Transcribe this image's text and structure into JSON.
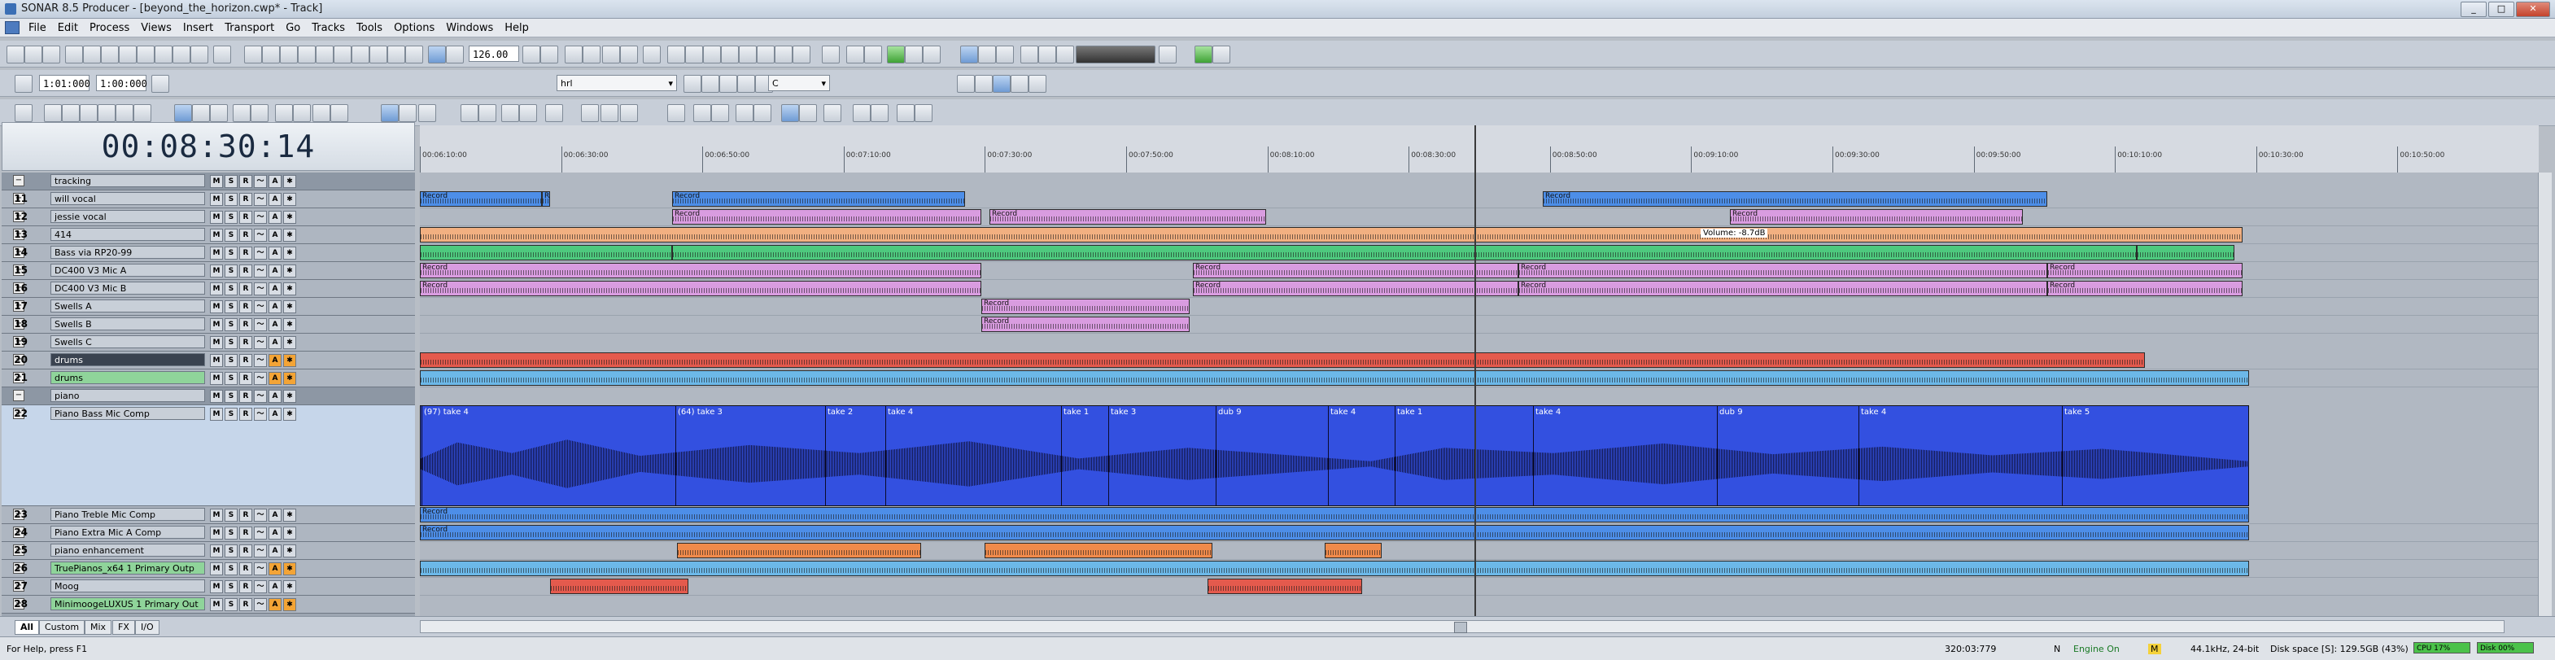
{
  "window": {
    "title": "SONAR 8.5 Producer - [beyond_the_horizon.cwp* - Track]"
  },
  "menubar": {
    "items": [
      "File",
      "Edit",
      "Process",
      "Views",
      "Insert",
      "Transport",
      "Go",
      "Tracks",
      "Tools",
      "Options",
      "Windows",
      "Help"
    ]
  },
  "toolbar": {
    "tempo": "126.00",
    "now_time": "1:01:000",
    "end_time": "1:00:000",
    "dropdown_1": "hrl",
    "dropdown_2": "C"
  },
  "clock": {
    "time": "00:08:30:14"
  },
  "ruler": {
    "labels": [
      "00:06:10:00",
      "00:06:30:00",
      "00:06:50:00",
      "00:07:10:00",
      "00:07:30:00",
      "00:07:50:00",
      "00:08:10:00",
      "00:08:30:00",
      "00:08:50:00",
      "00:09:10:00",
      "00:09:30:00",
      "00:09:50:00",
      "00:10:10:00",
      "00:10:30:00",
      "00:10:50:00"
    ]
  },
  "tracks": [
    {
      "num": "",
      "name": "tracking",
      "type": "folder"
    },
    {
      "num": "11",
      "name": "will vocal"
    },
    {
      "num": "12",
      "name": "jessie vocal"
    },
    {
      "num": "13",
      "name": "414"
    },
    {
      "num": "14",
      "name": "Bass via RP20-99"
    },
    {
      "num": "15",
      "name": "DC400 V3 Mic A"
    },
    {
      "num": "16",
      "name": "DC400 V3 Mic B"
    },
    {
      "num": "17",
      "name": "Swells A"
    },
    {
      "num": "18",
      "name": "Swells B"
    },
    {
      "num": "19",
      "name": "Swells C"
    },
    {
      "num": "20",
      "name": "drums",
      "style": "dark"
    },
    {
      "num": "21",
      "name": "drums",
      "style": "green"
    },
    {
      "num": "",
      "name": "piano",
      "type": "folder"
    },
    {
      "num": "22",
      "name": "Piano Bass Mic Comp",
      "style": "sel"
    },
    {
      "num": "23",
      "name": "Piano Treble Mic Comp"
    },
    {
      "num": "24",
      "name": "Piano Extra Mic A Comp"
    },
    {
      "num": "25",
      "name": "piano enhancement"
    },
    {
      "num": "26",
      "name": "TruePianos_x64 1 Primary Outp",
      "style": "green"
    },
    {
      "num": "27",
      "name": "Moog"
    },
    {
      "num": "28",
      "name": "MinimoogeLUXUS 1 Primary Out",
      "style": "green"
    }
  ],
  "big_clip": {
    "takes": [
      "(97) take 4",
      "(64) take 3",
      "take 2",
      "take 4",
      "take 1",
      "take 3",
      "dub 9",
      "take 4",
      "take 1",
      "take 4",
      "dub 9",
      "take 4",
      "take 5"
    ]
  },
  "clip_labels": {
    "record": "Record",
    "volume": "Volume: -8.7dB"
  },
  "bottom_tabs": [
    "All",
    "Custom",
    "Mix",
    "FX",
    "I/O"
  ],
  "status": {
    "help": "For Help, press F1",
    "position": "320:03:779",
    "mode": "N",
    "engine": "Engine On",
    "m_flag": "M",
    "sample_rate": "44.1kHz, 24-bit",
    "disk_space": "Disk space [S]: 129.5GB (43%)",
    "cpu": "CPU 17%",
    "disk": "Disk 00%"
  },
  "colors": {
    "vocal_clip": "#4d8ee8",
    "mic_clip": "#d99ce0",
    "bass_clip": "#4ec97e",
    "drums_clip": "#e45a4d",
    "piano_clip": "#3350e0",
    "enhancement_clip": "#f08a4b"
  }
}
